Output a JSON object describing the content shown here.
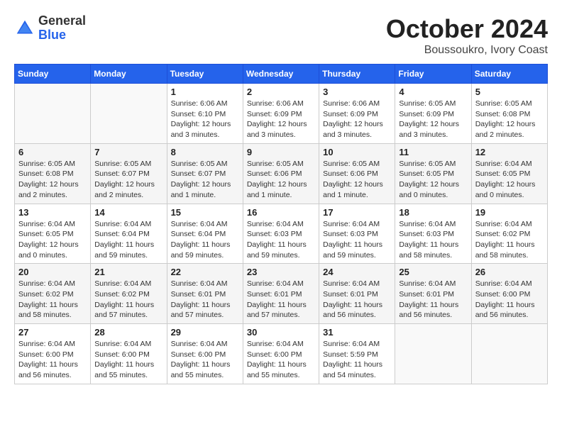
{
  "header": {
    "logo_general": "General",
    "logo_blue": "Blue",
    "month_title": "October 2024",
    "subtitle": "Boussoukro, Ivory Coast"
  },
  "weekdays": [
    "Sunday",
    "Monday",
    "Tuesday",
    "Wednesday",
    "Thursday",
    "Friday",
    "Saturday"
  ],
  "weeks": [
    [
      {
        "day": "",
        "info": ""
      },
      {
        "day": "",
        "info": ""
      },
      {
        "day": "1",
        "info": "Sunrise: 6:06 AM\nSunset: 6:10 PM\nDaylight: 12 hours and 3 minutes."
      },
      {
        "day": "2",
        "info": "Sunrise: 6:06 AM\nSunset: 6:09 PM\nDaylight: 12 hours and 3 minutes."
      },
      {
        "day": "3",
        "info": "Sunrise: 6:06 AM\nSunset: 6:09 PM\nDaylight: 12 hours and 3 minutes."
      },
      {
        "day": "4",
        "info": "Sunrise: 6:05 AM\nSunset: 6:09 PM\nDaylight: 12 hours and 3 minutes."
      },
      {
        "day": "5",
        "info": "Sunrise: 6:05 AM\nSunset: 6:08 PM\nDaylight: 12 hours and 2 minutes."
      }
    ],
    [
      {
        "day": "6",
        "info": "Sunrise: 6:05 AM\nSunset: 6:08 PM\nDaylight: 12 hours and 2 minutes."
      },
      {
        "day": "7",
        "info": "Sunrise: 6:05 AM\nSunset: 6:07 PM\nDaylight: 12 hours and 2 minutes."
      },
      {
        "day": "8",
        "info": "Sunrise: 6:05 AM\nSunset: 6:07 PM\nDaylight: 12 hours and 1 minute."
      },
      {
        "day": "9",
        "info": "Sunrise: 6:05 AM\nSunset: 6:06 PM\nDaylight: 12 hours and 1 minute."
      },
      {
        "day": "10",
        "info": "Sunrise: 6:05 AM\nSunset: 6:06 PM\nDaylight: 12 hours and 1 minute."
      },
      {
        "day": "11",
        "info": "Sunrise: 6:05 AM\nSunset: 6:05 PM\nDaylight: 12 hours and 0 minutes."
      },
      {
        "day": "12",
        "info": "Sunrise: 6:04 AM\nSunset: 6:05 PM\nDaylight: 12 hours and 0 minutes."
      }
    ],
    [
      {
        "day": "13",
        "info": "Sunrise: 6:04 AM\nSunset: 6:05 PM\nDaylight: 12 hours and 0 minutes."
      },
      {
        "day": "14",
        "info": "Sunrise: 6:04 AM\nSunset: 6:04 PM\nDaylight: 11 hours and 59 minutes."
      },
      {
        "day": "15",
        "info": "Sunrise: 6:04 AM\nSunset: 6:04 PM\nDaylight: 11 hours and 59 minutes."
      },
      {
        "day": "16",
        "info": "Sunrise: 6:04 AM\nSunset: 6:03 PM\nDaylight: 11 hours and 59 minutes."
      },
      {
        "day": "17",
        "info": "Sunrise: 6:04 AM\nSunset: 6:03 PM\nDaylight: 11 hours and 59 minutes."
      },
      {
        "day": "18",
        "info": "Sunrise: 6:04 AM\nSunset: 6:03 PM\nDaylight: 11 hours and 58 minutes."
      },
      {
        "day": "19",
        "info": "Sunrise: 6:04 AM\nSunset: 6:02 PM\nDaylight: 11 hours and 58 minutes."
      }
    ],
    [
      {
        "day": "20",
        "info": "Sunrise: 6:04 AM\nSunset: 6:02 PM\nDaylight: 11 hours and 58 minutes."
      },
      {
        "day": "21",
        "info": "Sunrise: 6:04 AM\nSunset: 6:02 PM\nDaylight: 11 hours and 57 minutes."
      },
      {
        "day": "22",
        "info": "Sunrise: 6:04 AM\nSunset: 6:01 PM\nDaylight: 11 hours and 57 minutes."
      },
      {
        "day": "23",
        "info": "Sunrise: 6:04 AM\nSunset: 6:01 PM\nDaylight: 11 hours and 57 minutes."
      },
      {
        "day": "24",
        "info": "Sunrise: 6:04 AM\nSunset: 6:01 PM\nDaylight: 11 hours and 56 minutes."
      },
      {
        "day": "25",
        "info": "Sunrise: 6:04 AM\nSunset: 6:01 PM\nDaylight: 11 hours and 56 minutes."
      },
      {
        "day": "26",
        "info": "Sunrise: 6:04 AM\nSunset: 6:00 PM\nDaylight: 11 hours and 56 minutes."
      }
    ],
    [
      {
        "day": "27",
        "info": "Sunrise: 6:04 AM\nSunset: 6:00 PM\nDaylight: 11 hours and 56 minutes."
      },
      {
        "day": "28",
        "info": "Sunrise: 6:04 AM\nSunset: 6:00 PM\nDaylight: 11 hours and 55 minutes."
      },
      {
        "day": "29",
        "info": "Sunrise: 6:04 AM\nSunset: 6:00 PM\nDaylight: 11 hours and 55 minutes."
      },
      {
        "day": "30",
        "info": "Sunrise: 6:04 AM\nSunset: 6:00 PM\nDaylight: 11 hours and 55 minutes."
      },
      {
        "day": "31",
        "info": "Sunrise: 6:04 AM\nSunset: 5:59 PM\nDaylight: 11 hours and 54 minutes."
      },
      {
        "day": "",
        "info": ""
      },
      {
        "day": "",
        "info": ""
      }
    ]
  ]
}
